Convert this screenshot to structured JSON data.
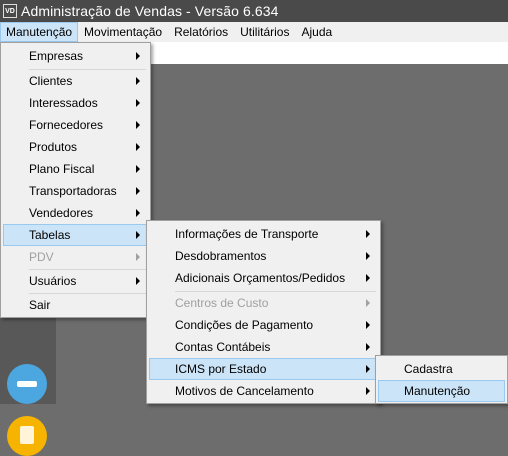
{
  "window": {
    "app_icon_text": "VD",
    "title": "Administração de Vendas - Versão 6.634"
  },
  "menubar": {
    "items": [
      "Manutenção",
      "Movimentação",
      "Relatórios",
      "Utilitários",
      "Ajuda"
    ],
    "active_index": 0
  },
  "manutencao_menu": {
    "items": [
      {
        "label": "Empresas",
        "submenu": true
      },
      {
        "label": "Clientes",
        "submenu": true
      },
      {
        "label": "Interessados",
        "submenu": true
      },
      {
        "label": "Fornecedores",
        "submenu": true
      },
      {
        "label": "Produtos",
        "submenu": true
      },
      {
        "label": "Plano Fiscal",
        "submenu": true
      },
      {
        "label": "Transportadoras",
        "submenu": true
      },
      {
        "label": "Vendedores",
        "submenu": true
      },
      {
        "label": "Tabelas",
        "submenu": true,
        "highlighted": true
      },
      {
        "label": "PDV",
        "submenu": true,
        "disabled": true
      },
      {
        "label": "Usuários",
        "submenu": true
      },
      {
        "label": "Sair",
        "submenu": false
      }
    ]
  },
  "tabelas_menu": {
    "items": [
      {
        "label": "Informações de Transporte",
        "submenu": true
      },
      {
        "label": "Desdobramentos",
        "submenu": true
      },
      {
        "label": "Adicionais Orçamentos/Pedidos",
        "submenu": true
      },
      {
        "label": "Centros de Custo",
        "submenu": true,
        "disabled": true
      },
      {
        "label": "Condições de Pagamento",
        "submenu": true
      },
      {
        "label": "Contas Contábeis",
        "submenu": true
      },
      {
        "label": "ICMS por Estado",
        "submenu": true,
        "highlighted": true
      },
      {
        "label": "Motivos de Cancelamento",
        "submenu": true
      }
    ]
  },
  "icms_menu": {
    "items": [
      {
        "label": "Cadastra"
      },
      {
        "label": "Manutenção",
        "highlighted": true
      }
    ]
  },
  "side_icons": [
    "list-icon",
    "document-icon"
  ],
  "colors": {
    "menu_bg": "#f0f0f0",
    "highlight": "#cce4f7",
    "highlight_border": "#99c9ef",
    "titlebar": "#4a4a4a",
    "disabled_text": "#a0a0a0"
  }
}
